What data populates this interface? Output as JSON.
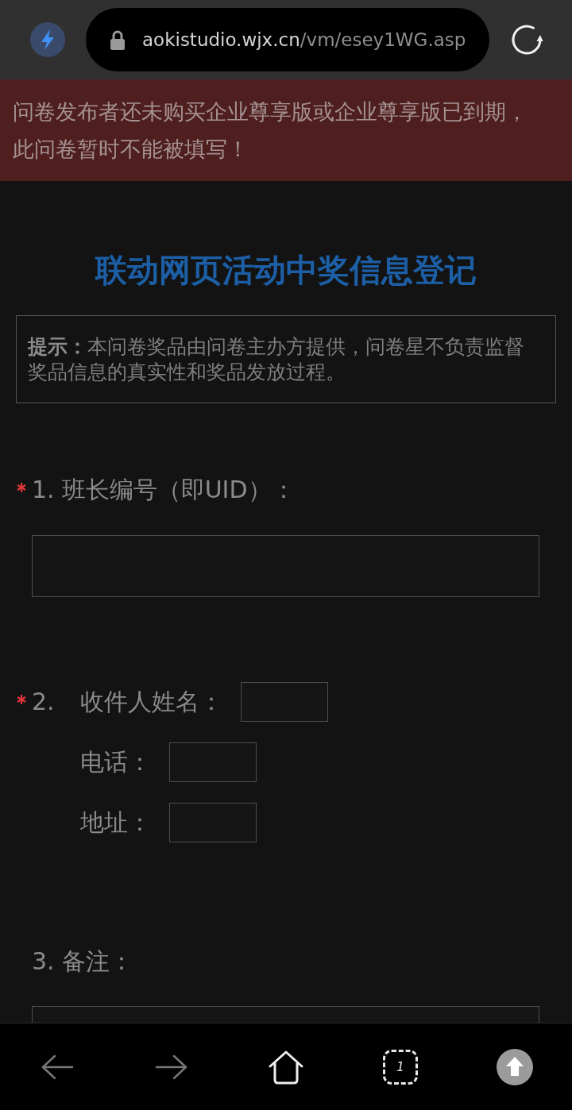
{
  "browser_bar": {
    "url_host": "aokistudio.wjx.cn",
    "url_path": "/vm/esey1WG.asp"
  },
  "banner": {
    "text": "问卷发布者还未购买企业尊享版或企业尊享版已到期，此问卷暂时不能被填写！"
  },
  "survey": {
    "title": "联动网页活动中奖信息登记",
    "notice": "**提示：**本问卷奖品由问卷主办方提供，问卷星不负责监督奖品信息的真实性和奖品发放过程。",
    "questions": [
      {
        "kind": "text",
        "required": true,
        "number": "1.",
        "label": "班长编号（即UID）："
      },
      {
        "kind": "fields",
        "required": true,
        "number": "2.",
        "fields": [
          {
            "label": "收件人姓名："
          },
          {
            "label": "电话："
          },
          {
            "label": "地址："
          }
        ]
      },
      {
        "kind": "textarea",
        "required": false,
        "number": "3.",
        "label": "备注："
      }
    ]
  },
  "bottom_nav": {
    "tab_count": "1"
  }
}
